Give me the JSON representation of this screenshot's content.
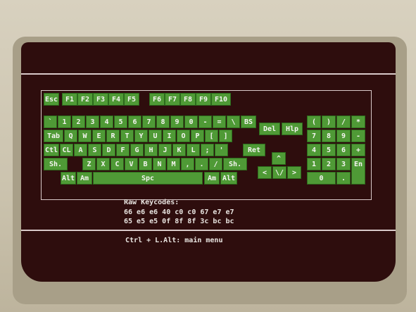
{
  "keyboard": {
    "function_row": [
      "Esc",
      "F1",
      "F2",
      "F3",
      "F4",
      "F5",
      "F6",
      "F7",
      "F8",
      "F9",
      "F10"
    ],
    "editing_keys": [
      "Del",
      "Hlp"
    ],
    "number_row": [
      "`",
      "1",
      "2",
      "3",
      "4",
      "5",
      "6",
      "7",
      "8",
      "9",
      "0",
      "-",
      "=",
      "\\",
      "BS"
    ],
    "q_row": [
      "Tab",
      "Q",
      "W",
      "E",
      "R",
      "T",
      "Y",
      "U",
      "I",
      "O",
      "P",
      "[",
      "]"
    ],
    "a_row": [
      "Ctl",
      "CL",
      "A",
      "S",
      "D",
      "F",
      "G",
      "H",
      "J",
      "K",
      "L",
      ";",
      "'",
      "",
      "Ret"
    ],
    "z_row": [
      "Sh.",
      "",
      "Z",
      "X",
      "C",
      "V",
      "B",
      "N",
      "M",
      ",",
      ".",
      "/",
      "Sh."
    ],
    "bottom_row": [
      "Alt",
      "Am",
      "Spc",
      "Am",
      "Alt"
    ],
    "arrows": [
      "^",
      "<",
      "\\/",
      ">"
    ],
    "numpad": [
      "(",
      ")",
      "/",
      "*",
      "7",
      "8",
      "9",
      "-",
      "4",
      "5",
      "6",
      "+",
      "1",
      "2",
      "3",
      "En",
      "0",
      "."
    ]
  },
  "raw_keycodes": {
    "label": "Raw Keycodes:",
    "line1": "66 e6 e6 40 c0 c0 67 e7 e7",
    "line2": "65 e5 e5 0f 8f 8f 3c bc bc"
  },
  "footer": {
    "hint": "Ctrl + L.Alt: main menu"
  },
  "colors": {
    "key": "#4f9a36",
    "screen": "#2e0d0d",
    "text": "#e8e4e0"
  }
}
